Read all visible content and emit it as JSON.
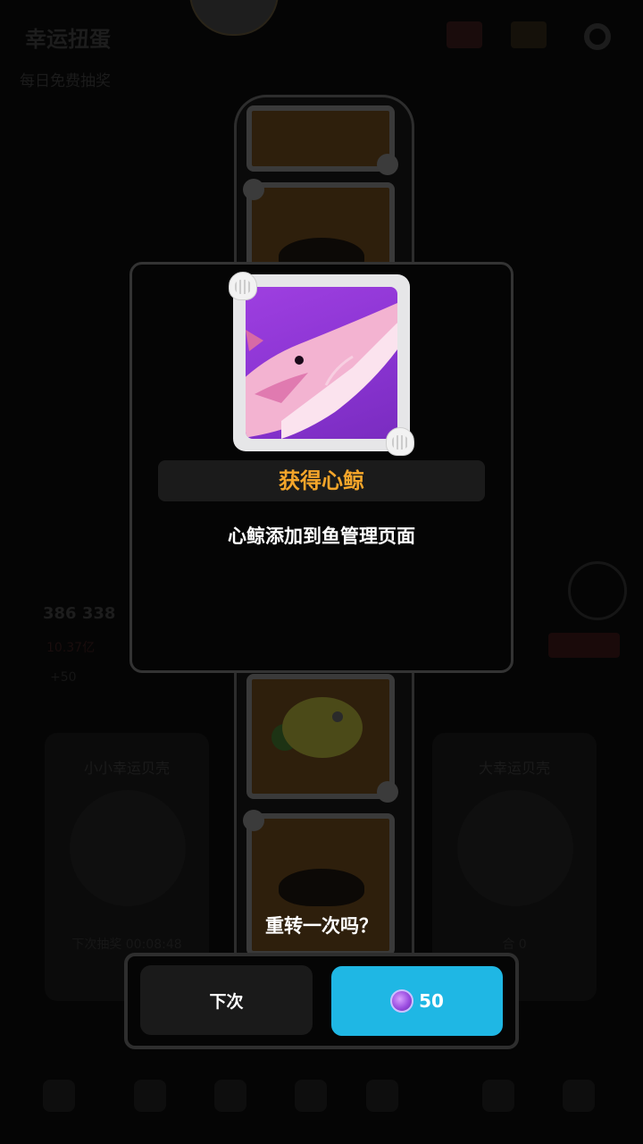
{
  "background": {
    "title": "幸运扭蛋",
    "subtitle": "每日免费抽奖",
    "stat_main": "386 338",
    "stat_second": "10.37亿",
    "stat_third": "+50",
    "left_card_title": "小小幸运贝壳",
    "left_card_footer": "下次抽奖 00:08:48",
    "right_card_title": "大幸运贝壳",
    "right_card_footer": "合 0"
  },
  "reward": {
    "title": "获得心鲸",
    "description": "心鲸添加到鱼管理页面",
    "fish_icon": "pink-whale-icon"
  },
  "retry": {
    "question": "重转一次吗？",
    "later_label": "下次",
    "spin_cost": "50",
    "cost_icon": "purple-gem-icon"
  },
  "colors": {
    "accent_title": "#f4a52a",
    "spin_button": "#1fb7e4",
    "frame_bg": "#8a34d2"
  }
}
